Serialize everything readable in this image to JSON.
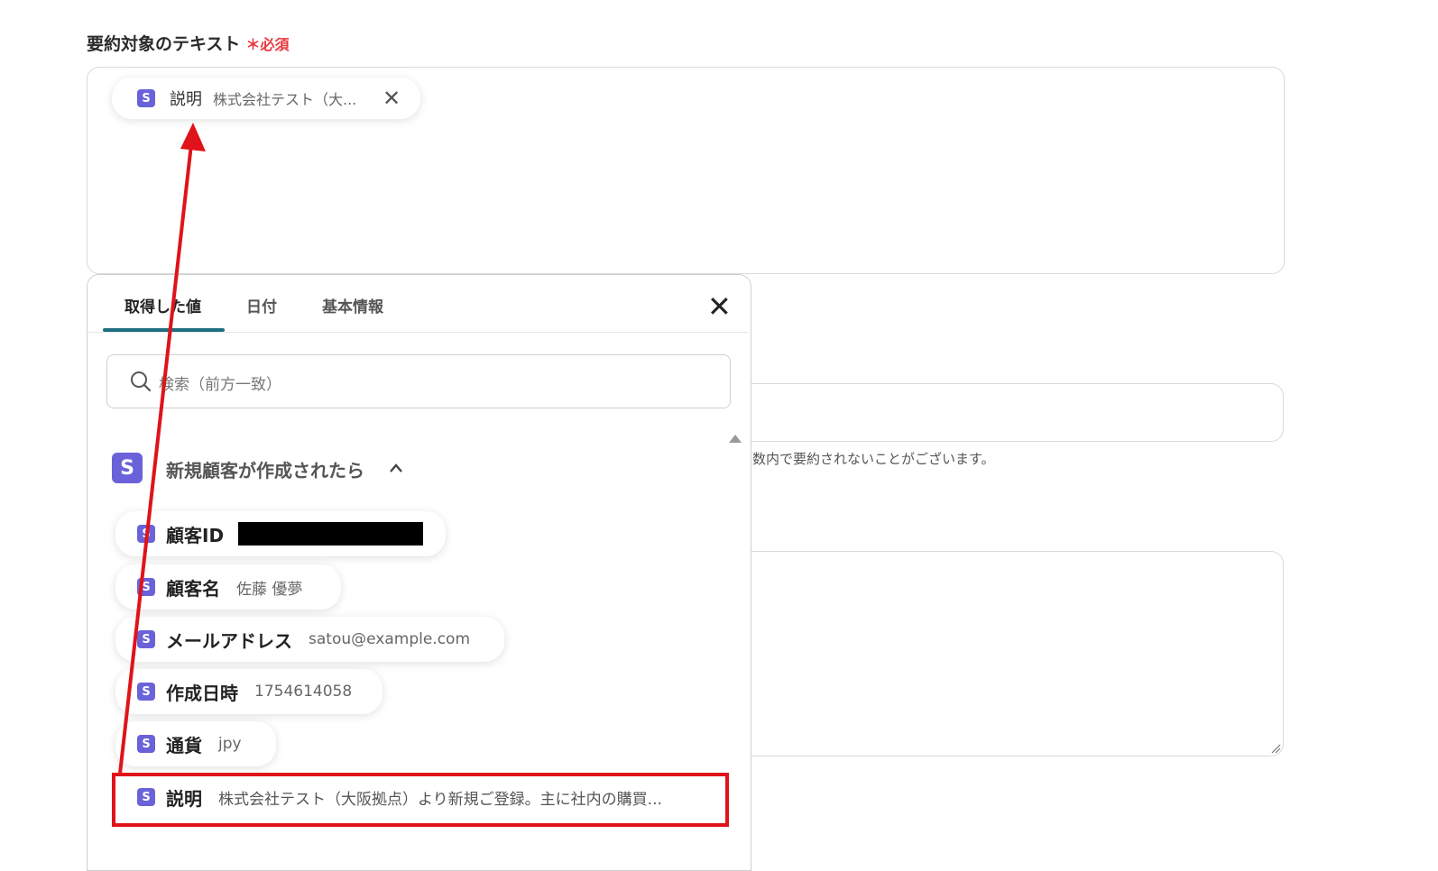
{
  "field": {
    "label": "要約対象のテキスト",
    "required_mark": "＊",
    "required_label": "必須"
  },
  "selected_chip": {
    "icon": "S",
    "name": "説明",
    "value": "株式会社テスト（大...",
    "remove_glyph": "✕"
  },
  "background": {
    "help_text": "数内で要約されないことがございます。"
  },
  "picker": {
    "tabs": [
      {
        "label": "取得した値"
      },
      {
        "label": "日付"
      },
      {
        "label": "基本情報"
      }
    ],
    "active_tab": "取得した値",
    "close_glyph": "✕",
    "search_placeholder": "検索（前方一致）",
    "group": {
      "icon": "S",
      "title": "新規顧客が作成されたら"
    },
    "items": [
      {
        "icon": "S",
        "name": "顧客ID",
        "value": "",
        "redacted": true
      },
      {
        "icon": "S",
        "name": "顧客名",
        "value": "佐藤 優夢"
      },
      {
        "icon": "S",
        "name": "メールアドレス",
        "value": "satou@example.com"
      },
      {
        "icon": "S",
        "name": "作成日時",
        "value": "1754614058"
      },
      {
        "icon": "S",
        "name": "通貨",
        "value": "jpy"
      },
      {
        "icon": "S",
        "name": "説明",
        "value": "株式会社テスト（大阪拠点）より新規ご登録。主に社内の購買...",
        "highlighted": true
      }
    ]
  },
  "colors": {
    "accent": "#6a62d9",
    "tab_underline": "#1f6e7f",
    "highlight": "#e0131a",
    "required": "#e8383d"
  }
}
